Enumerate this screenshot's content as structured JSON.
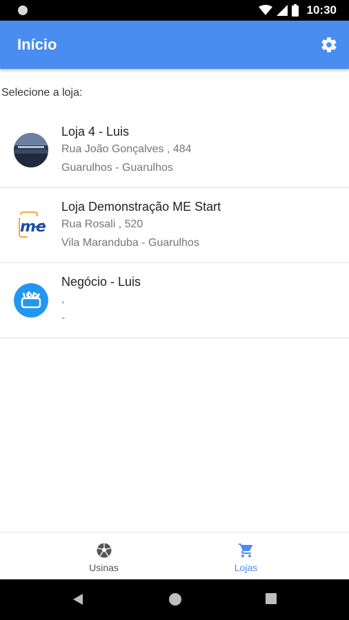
{
  "status_bar": {
    "time": "10:30"
  },
  "app_bar": {
    "title": "Início",
    "settings_icon": "gear-icon",
    "color": "#4a8df0"
  },
  "subtitle": "Selecione a loja:",
  "stores": [
    {
      "name": "Loja 4 - Luis",
      "address": "Rua João Gonçalves , 484",
      "city": "Guarulhos - Guarulhos",
      "avatar": "store-photo"
    },
    {
      "name": "Loja Demonstração ME Start",
      "address": "Rua Rosali , 520",
      "city": "Vila Maranduba - Guarulhos",
      "avatar": "me-start-logo",
      "logo_text": "me"
    },
    {
      "name": "Negócio - Luis",
      "address": ",",
      "city": "-",
      "avatar": "laundry-icon"
    }
  ],
  "bottom_nav": {
    "items": [
      {
        "label": "Usinas",
        "icon": "soccer-ball-icon",
        "active": false
      },
      {
        "label": "Lojas",
        "icon": "cart-icon",
        "active": true
      }
    ]
  }
}
